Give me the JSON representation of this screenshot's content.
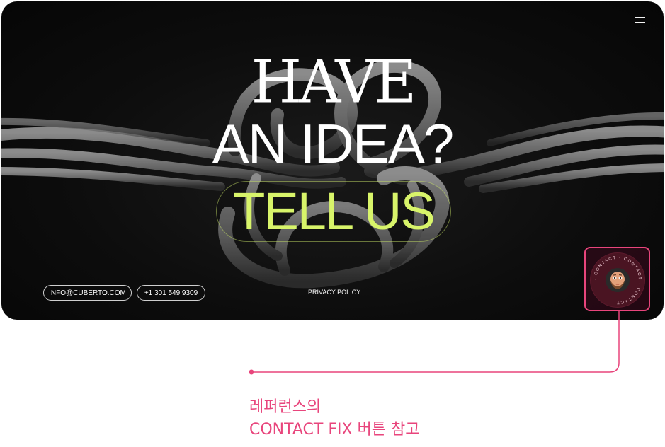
{
  "hero": {
    "headline_line1": "HAVE",
    "headline_line2": "AN IDEA?",
    "cta_label": "TELL US"
  },
  "footer": {
    "email": "INFO@CUBERTO.COM",
    "phone": "+1 301 549 9309",
    "privacy": "PRIVACY POLICY"
  },
  "contact_button": {
    "ring_text": "· CONTACT · CONTACT · CONTACT ",
    "avatar_icon": "memoji-avatar-icon"
  },
  "annotation": {
    "line1": "레퍼런스의",
    "line2": "CONTACT FIX 버튼 참고"
  },
  "colors": {
    "accent_lime": "#d8f46a",
    "annotation_pink": "#e8457c",
    "hero_bg": "#0a0a0a"
  },
  "icons": {
    "menu": "hamburger-menu-icon"
  }
}
